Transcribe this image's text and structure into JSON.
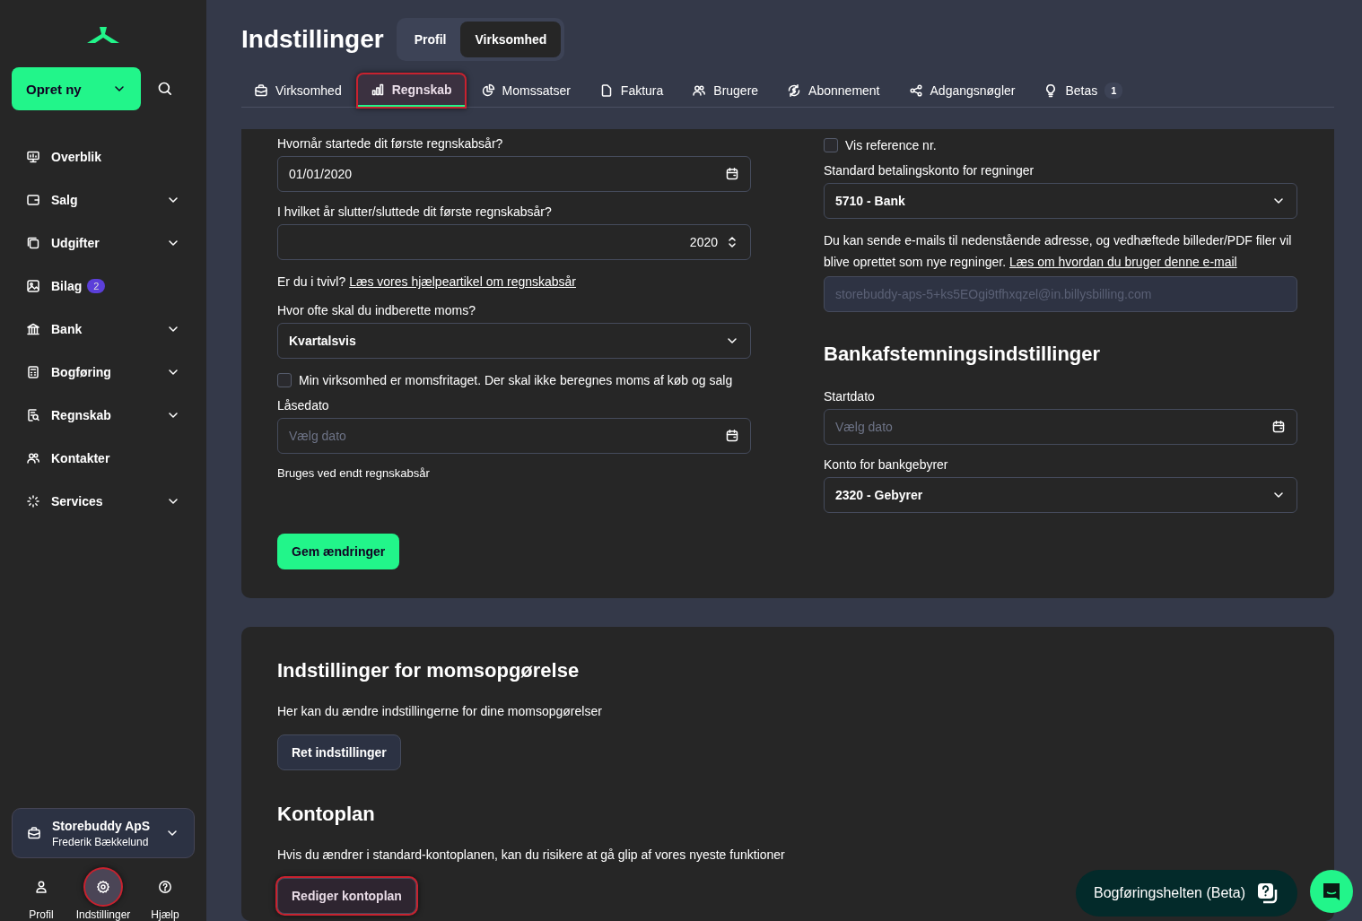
{
  "sidebar": {
    "create_button": {
      "label": "Opret ny"
    },
    "items": [
      {
        "label": "Overblik",
        "expandable": false
      },
      {
        "label": "Salg",
        "expandable": true
      },
      {
        "label": "Udgifter",
        "expandable": true
      },
      {
        "label": "Bilag",
        "expandable": false,
        "badge": "2"
      },
      {
        "label": "Bank",
        "expandable": true
      },
      {
        "label": "Bogføring",
        "expandable": true
      },
      {
        "label": "Regnskab",
        "expandable": true
      },
      {
        "label": "Kontakter",
        "expandable": false
      },
      {
        "label": "Services",
        "expandable": true
      }
    ],
    "company": {
      "name": "Storebuddy ApS",
      "user": "Frederik Bækkelund"
    },
    "bottom_nav": [
      {
        "label": "Profil",
        "selected": false,
        "highlighted": false
      },
      {
        "label": "Indstillinger",
        "selected": true,
        "highlighted": true
      },
      {
        "label": "Hjælp",
        "selected": false,
        "highlighted": false
      }
    ]
  },
  "header": {
    "title": "Indstillinger",
    "toggle": [
      {
        "label": "Profil",
        "selected": false
      },
      {
        "label": "Virksomhed",
        "selected": true
      }
    ]
  },
  "tabs": [
    {
      "label": "Virksomhed",
      "selected": false,
      "highlighted": false
    },
    {
      "label": "Regnskab",
      "selected": true,
      "highlighted": true
    },
    {
      "label": "Momssatser",
      "selected": false,
      "highlighted": false
    },
    {
      "label": "Faktura",
      "selected": false,
      "highlighted": false
    },
    {
      "label": "Brugere",
      "selected": false,
      "highlighted": false
    },
    {
      "label": "Abonnement",
      "selected": false,
      "highlighted": false
    },
    {
      "label": "Adgangsnøgler",
      "selected": false,
      "highlighted": false
    },
    {
      "label": "Betas",
      "selected": false,
      "highlighted": false,
      "badge": "1"
    }
  ],
  "accounting_card": {
    "left": [
      {
        "kind": "label",
        "text": "Hvornår startede dit første regnskabsår?"
      },
      {
        "kind": "date",
        "value": "01/01/2020"
      },
      {
        "kind": "label",
        "text": "I hvilket år slutter/sluttede dit første regnskabsår?"
      },
      {
        "kind": "number",
        "value": "2020"
      },
      {
        "kind": "help",
        "text": "Er du i tvivl?",
        "link": "Læs vores hjælpeartikel om regnskabsår"
      },
      {
        "kind": "label",
        "text": "Hvor ofte skal du indberette moms?"
      },
      {
        "kind": "select",
        "value": "Kvartalsvis"
      },
      {
        "kind": "checkbox",
        "text": "Min virksomhed er momsfritaget. Der skal ikke beregnes moms af køb og salg",
        "checked": false
      },
      {
        "kind": "label",
        "text": "Låsedato"
      },
      {
        "kind": "date",
        "placeholder": "Vælg dato"
      },
      {
        "kind": "hint",
        "text": "Bruges ved endt regnskabsår"
      }
    ],
    "right": [
      {
        "kind": "checkbox",
        "text": "Vis reference nr.",
        "checked": false
      },
      {
        "kind": "label",
        "text": "Standard betalingskonto for regninger"
      },
      {
        "kind": "select",
        "value": "5710 -  Bank"
      },
      {
        "kind": "help",
        "text": "Du kan sende e-mails til nedenstående adresse, og vedhæftede billeder/PDF filer vil blive oprettet som nye regninger.",
        "link": "Læs om hvordan du bruger denne e-mail"
      },
      {
        "kind": "readonly",
        "placeholder": "storebuddy-aps-5+ks5EOgi9tfhxqzel@in.billysbilling.com"
      },
      {
        "kind": "heading",
        "text": "Bankafstemningsindstillinger"
      },
      {
        "kind": "label",
        "text": "Startdato"
      },
      {
        "kind": "date",
        "placeholder": "Vælg dato"
      },
      {
        "kind": "label",
        "text": "Konto for bankgebyrer"
      },
      {
        "kind": "select",
        "value": "2320 -  Gebyrer"
      }
    ],
    "save_button": {
      "label": "Gem ændringer"
    }
  },
  "sections": [
    {
      "heading": "Indstillinger for momsopgørelse",
      "text": "Her kan du ændre indstillingerne for dine momsopgørelser",
      "button": {
        "label": "Ret indstillinger",
        "highlighted": false
      }
    },
    {
      "heading": "Kontoplan",
      "text": "Hvis du ændrer i standard-kontoplanen, kan du risikere at gå glip af vores nyeste funktioner",
      "button": {
        "label": "Rediger kontoplan",
        "highlighted": true
      }
    }
  ],
  "assistant_button": {
    "label": "Bogføringshelten (Beta)"
  }
}
